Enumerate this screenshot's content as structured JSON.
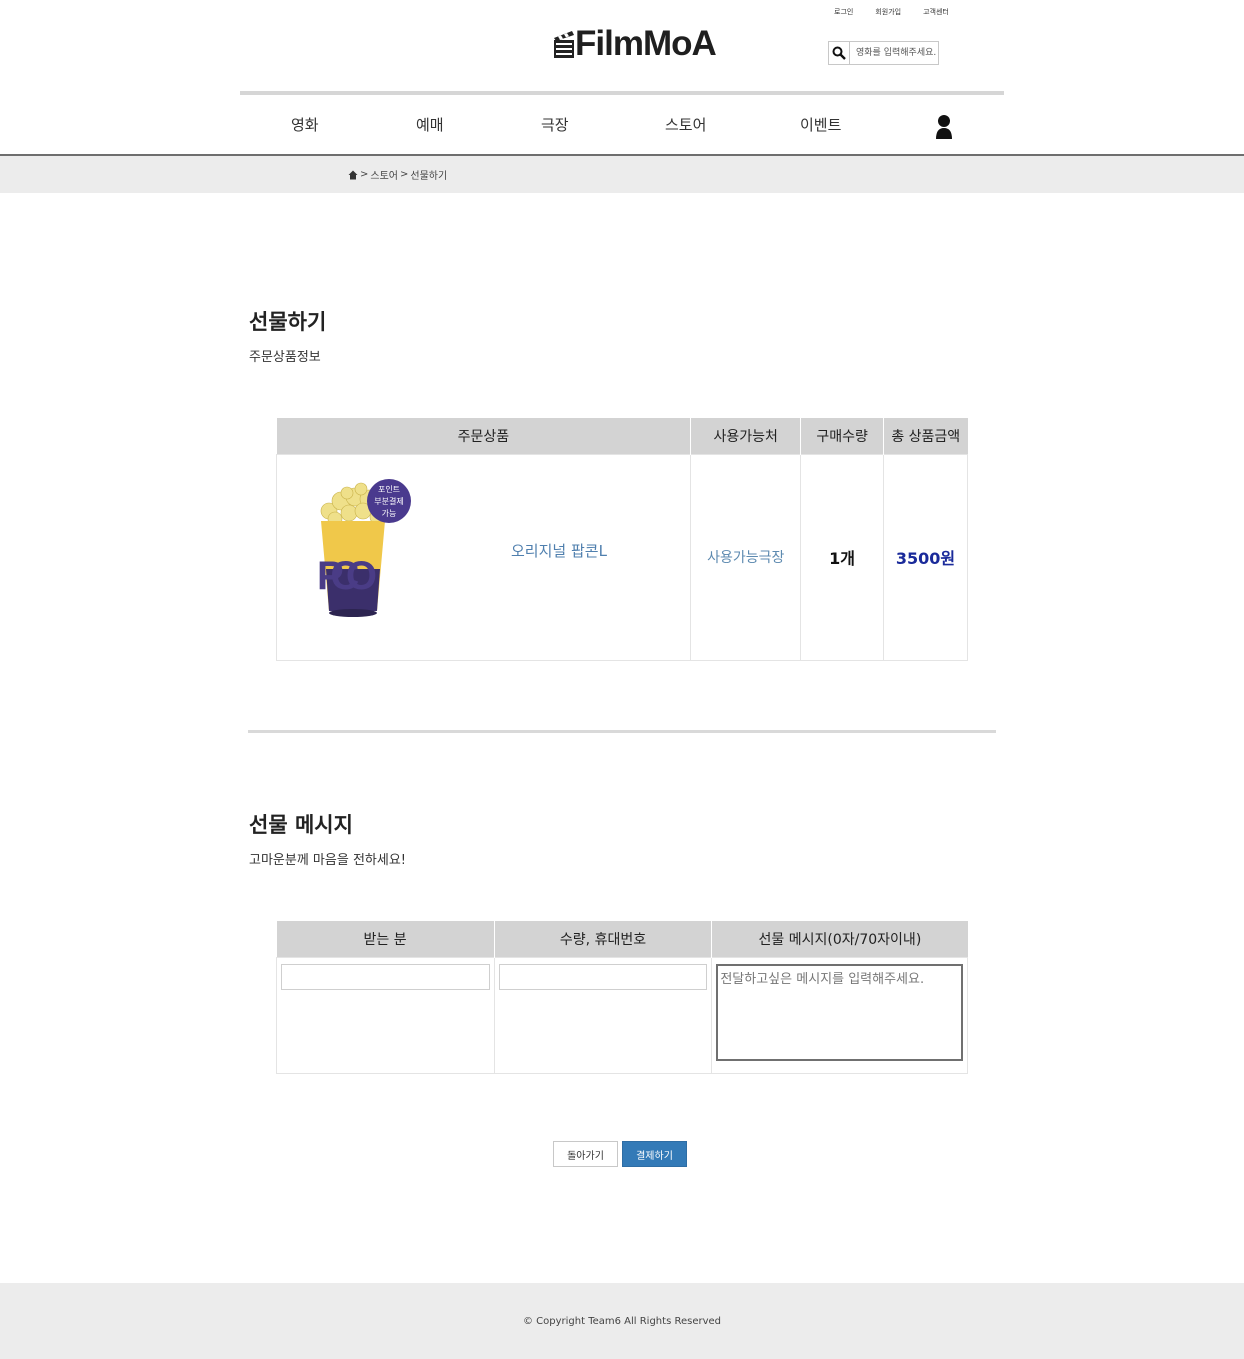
{
  "header": {
    "top_links": [
      "로그인",
      "회원가입",
      "고객센터"
    ],
    "logo_text": "FilmMoA",
    "search_placeholder": "영화를 입력해주세요."
  },
  "nav": {
    "items": [
      "영화",
      "예매",
      "극장",
      "스토어",
      "이벤트"
    ]
  },
  "breadcrumb": {
    "store": "스토어",
    "current": "선물하기",
    "separator": ">"
  },
  "order_section": {
    "title": "선물하기",
    "subtitle": "주문상품정보",
    "columns": [
      "주문상품",
      "사용가능처",
      "구매수량",
      "총 상품금액"
    ],
    "product": {
      "name": "오리지널 팝콘L",
      "badge_lines": [
        "포인트",
        "부분결제",
        "가능"
      ],
      "cup_text": "PCO",
      "place": "사용가능극장",
      "quantity": "1개",
      "price": "3500원"
    }
  },
  "message_section": {
    "title": "선물 메시지",
    "subtitle": "고마운분께 마음을 전하세요!",
    "columns": [
      "받는 분",
      "수량, 휴대번호",
      "선물 메시지(0자/70자이내)"
    ],
    "recipient_value": "",
    "phone_value": "",
    "message_placeholder": "전달하고싶은 메시지를 입력해주세요."
  },
  "buttons": {
    "back": "돌아가기",
    "pay": "결제하기"
  },
  "footer": {
    "copyright": "© Copyright Team6 All Rights Reserved"
  },
  "colors": {
    "pay_button": "#337ab7",
    "price": "#1a2a9a",
    "link": "#4f7fae",
    "table_header": "#d3d3d3"
  }
}
